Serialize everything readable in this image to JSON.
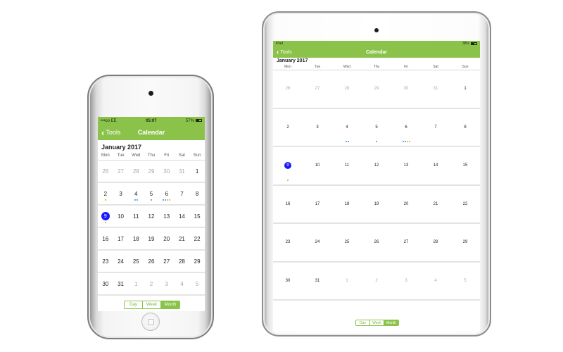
{
  "phone": {
    "status": {
      "left": "•••oo EE",
      "time": "05:07",
      "battery": "57%"
    },
    "nav": {
      "back_label": "Tools",
      "title": "Calendar"
    },
    "month_title": "January 2017",
    "weekdays": [
      "Mon",
      "Tue",
      "Wed",
      "Thu",
      "Fri",
      "Sat",
      "Sun"
    ],
    "days": [
      {
        "d": "26",
        "m": 1
      },
      {
        "d": "27",
        "m": 1
      },
      {
        "d": "28",
        "m": 1
      },
      {
        "d": "29",
        "m": 1
      },
      {
        "d": "30",
        "m": 1
      },
      {
        "d": "31",
        "m": 1
      },
      {
        "d": "1",
        "m": 0
      },
      {
        "d": "2",
        "m": 0,
        "dots": [
          "#f0a000"
        ]
      },
      {
        "d": "3",
        "m": 0
      },
      {
        "d": "4",
        "m": 0,
        "dots": [
          "#4a90d9",
          "#4a90d9"
        ]
      },
      {
        "d": "5",
        "m": 0,
        "dots": [
          "#4a90d9"
        ]
      },
      {
        "d": "6",
        "m": 0,
        "dots": [
          "#4a90d9",
          "#4a90d9",
          "#8bc34a",
          "#f0a000"
        ]
      },
      {
        "d": "7",
        "m": 0
      },
      {
        "d": "8",
        "m": 0
      },
      {
        "d": "9",
        "m": 0,
        "today": 1,
        "dots": [
          "#f0a000"
        ]
      },
      {
        "d": "10",
        "m": 0
      },
      {
        "d": "11",
        "m": 0
      },
      {
        "d": "12",
        "m": 0
      },
      {
        "d": "13",
        "m": 0
      },
      {
        "d": "14",
        "m": 0
      },
      {
        "d": "15",
        "m": 0
      },
      {
        "d": "16",
        "m": 0
      },
      {
        "d": "17",
        "m": 0
      },
      {
        "d": "18",
        "m": 0
      },
      {
        "d": "19",
        "m": 0
      },
      {
        "d": "20",
        "m": 0
      },
      {
        "d": "21",
        "m": 0
      },
      {
        "d": "22",
        "m": 0
      },
      {
        "d": "23",
        "m": 0
      },
      {
        "d": "24",
        "m": 0
      },
      {
        "d": "25",
        "m": 0
      },
      {
        "d": "26",
        "m": 0
      },
      {
        "d": "27",
        "m": 0
      },
      {
        "d": "28",
        "m": 0
      },
      {
        "d": "29",
        "m": 0
      },
      {
        "d": "30",
        "m": 0
      },
      {
        "d": "31",
        "m": 0
      },
      {
        "d": "1",
        "m": 1
      },
      {
        "d": "2",
        "m": 1
      },
      {
        "d": "3",
        "m": 1
      },
      {
        "d": "4",
        "m": 1
      },
      {
        "d": "5",
        "m": 1
      }
    ],
    "segments": [
      {
        "label": "Day",
        "active": 0
      },
      {
        "label": "Week",
        "active": 0
      },
      {
        "label": "Month",
        "active": 1
      }
    ]
  },
  "tablet": {
    "status": {
      "left": "iPad",
      "time": "",
      "battery": "38%"
    },
    "nav": {
      "back_label": "Tools",
      "title": "Calendar"
    },
    "month_title": "January 2017",
    "weekdays": [
      "Mon",
      "Tue",
      "Wed",
      "Thu",
      "Fri",
      "Sat",
      "Sun"
    ],
    "days": [
      {
        "d": "26",
        "m": 1
      },
      {
        "d": "27",
        "m": 1
      },
      {
        "d": "28",
        "m": 1
      },
      {
        "d": "29",
        "m": 1
      },
      {
        "d": "30",
        "m": 1
      },
      {
        "d": "31",
        "m": 1
      },
      {
        "d": "1",
        "m": 0
      },
      {
        "d": "2",
        "m": 0
      },
      {
        "d": "3",
        "m": 0
      },
      {
        "d": "4",
        "m": 0,
        "dots": [
          "#4a90d9",
          "#4a90d9"
        ]
      },
      {
        "d": "5",
        "m": 0,
        "dots": [
          "#4a90d9"
        ]
      },
      {
        "d": "6",
        "m": 0,
        "dots": [
          "#4a90d9",
          "#4a90d9",
          "#8bc34a",
          "#f0a000"
        ]
      },
      {
        "d": "7",
        "m": 0
      },
      {
        "d": "8",
        "m": 0
      },
      {
        "d": "9",
        "m": 0,
        "today": 1,
        "dots": [
          "#f0a000"
        ]
      },
      {
        "d": "10",
        "m": 0
      },
      {
        "d": "11",
        "m": 0
      },
      {
        "d": "12",
        "m": 0
      },
      {
        "d": "13",
        "m": 0
      },
      {
        "d": "14",
        "m": 0
      },
      {
        "d": "15",
        "m": 0
      },
      {
        "d": "16",
        "m": 0
      },
      {
        "d": "17",
        "m": 0
      },
      {
        "d": "18",
        "m": 0
      },
      {
        "d": "19",
        "m": 0
      },
      {
        "d": "20",
        "m": 0
      },
      {
        "d": "21",
        "m": 0
      },
      {
        "d": "22",
        "m": 0
      },
      {
        "d": "23",
        "m": 0
      },
      {
        "d": "24",
        "m": 0
      },
      {
        "d": "25",
        "m": 0
      },
      {
        "d": "26",
        "m": 0
      },
      {
        "d": "27",
        "m": 0
      },
      {
        "d": "28",
        "m": 0
      },
      {
        "d": "29",
        "m": 0
      },
      {
        "d": "30",
        "m": 0
      },
      {
        "d": "31",
        "m": 0
      },
      {
        "d": "1",
        "m": 1
      },
      {
        "d": "2",
        "m": 1
      },
      {
        "d": "3",
        "m": 1
      },
      {
        "d": "4",
        "m": 1
      },
      {
        "d": "5",
        "m": 1
      }
    ],
    "segments": [
      {
        "label": "Day",
        "active": 0
      },
      {
        "label": "Week",
        "active": 0
      },
      {
        "label": "Month",
        "active": 1
      }
    ]
  },
  "colors": {
    "accent": "#8bc34a",
    "today": "#1a1aff",
    "muted_text": "#a8a8a8"
  }
}
